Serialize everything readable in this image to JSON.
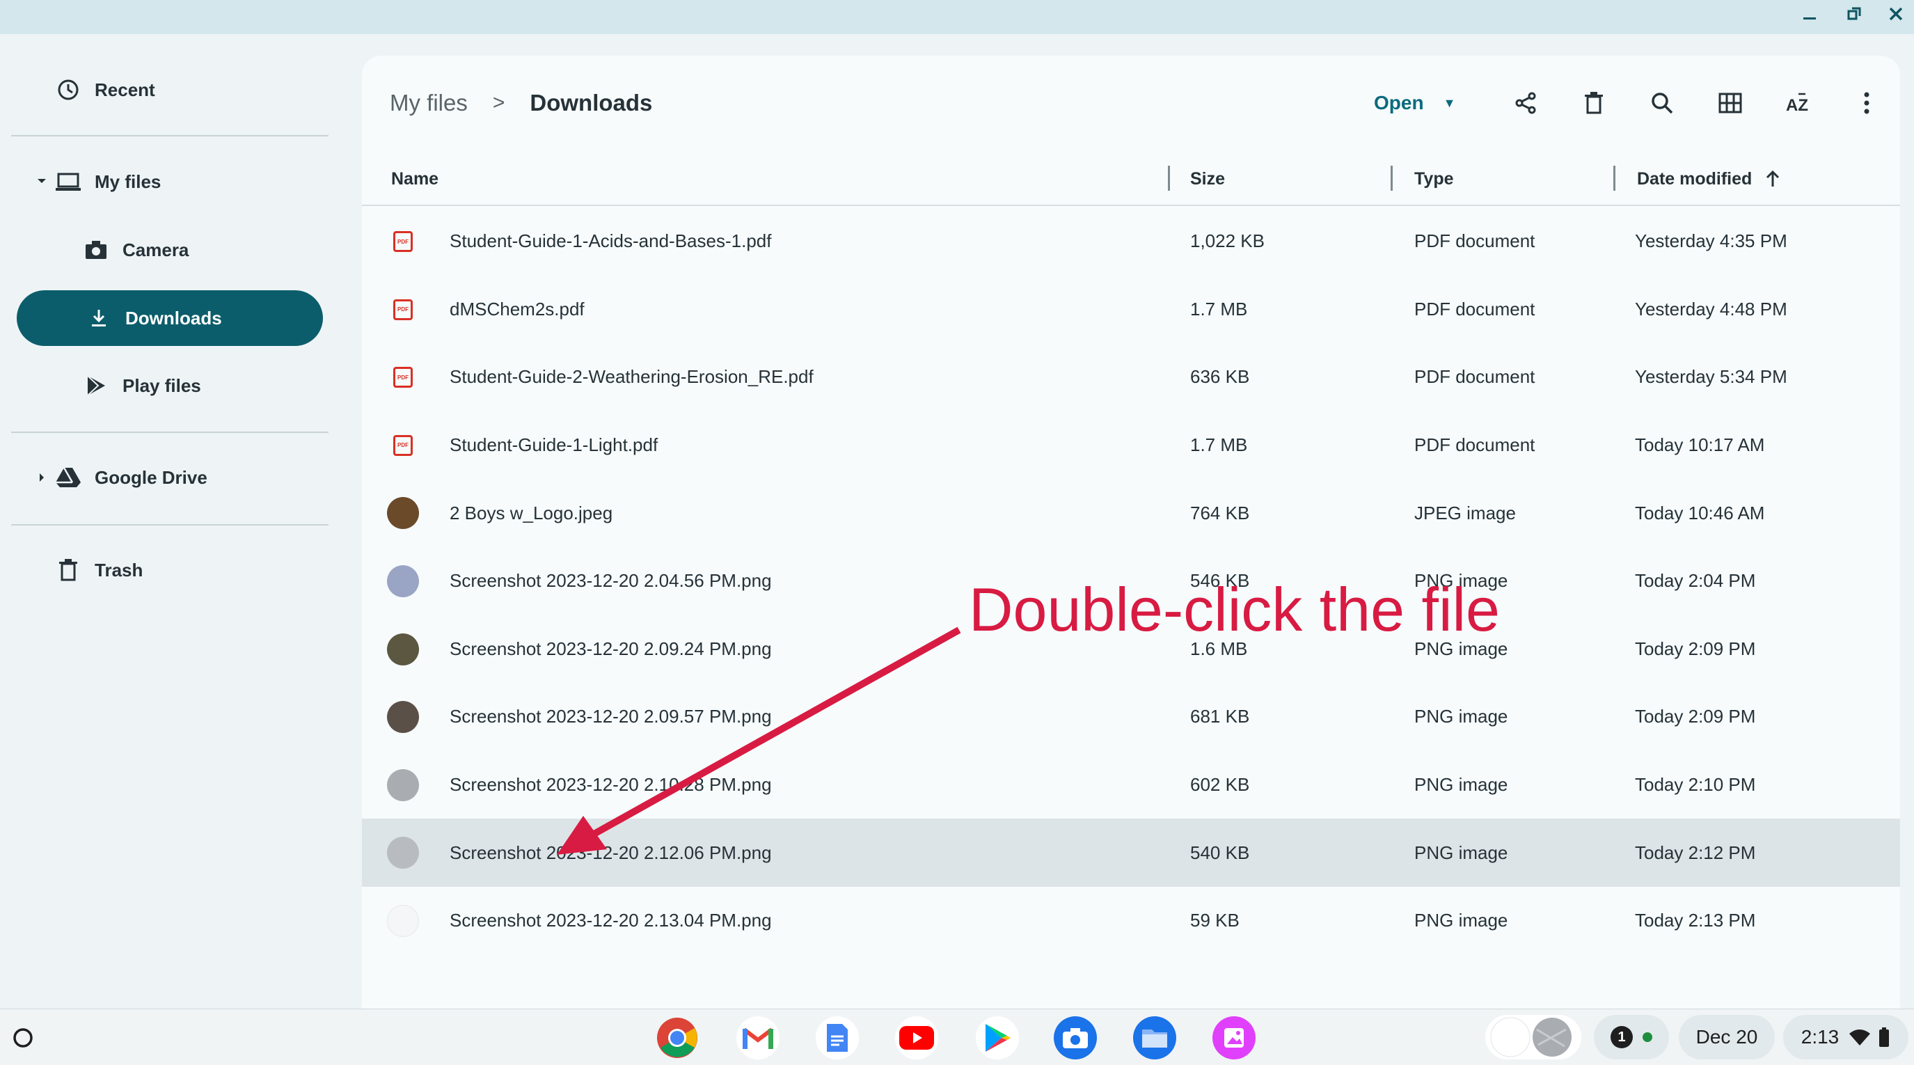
{
  "sidebar": {
    "recent": "Recent",
    "my_files": "My files",
    "camera": "Camera",
    "downloads": "Downloads",
    "play_files": "Play files",
    "google_drive": "Google Drive",
    "trash": "Trash"
  },
  "header": {
    "breadcrumb_root": "My files",
    "breadcrumb_sep": ">",
    "breadcrumb_current": "Downloads",
    "open_label": "Open"
  },
  "columns": {
    "name": "Name",
    "size": "Size",
    "type": "Type",
    "date": "Date modified"
  },
  "files": [
    {
      "name": "Student-Guide-1-Acids-and-Bases-1.pdf",
      "size": "1,022 KB",
      "type": "PDF document",
      "date": "Yesterday 4:35 PM",
      "kind": "pdf"
    },
    {
      "name": "dMSChem2s.pdf",
      "size": "1.7 MB",
      "type": "PDF document",
      "date": "Yesterday 4:48 PM",
      "kind": "pdf"
    },
    {
      "name": "Student-Guide-2-Weathering-Erosion_RE.pdf",
      "size": "636 KB",
      "type": "PDF document",
      "date": "Yesterday 5:34 PM",
      "kind": "pdf"
    },
    {
      "name": "Student-Guide-1-Light.pdf",
      "size": "1.7 MB",
      "type": "PDF document",
      "date": "Today 10:17 AM",
      "kind": "pdf"
    },
    {
      "name": "2 Boys w_Logo.jpeg",
      "size": "764 KB",
      "type": "JPEG image",
      "date": "Today 10:46 AM",
      "kind": "img",
      "color": "#6b4a2a"
    },
    {
      "name": "Screenshot 2023-12-20 2.04.56 PM.png",
      "size": "546 KB",
      "type": "PNG image",
      "date": "Today 2:04 PM",
      "kind": "img",
      "color": "#9aa4c4"
    },
    {
      "name": "Screenshot 2023-12-20 2.09.24 PM.png",
      "size": "1.6 MB",
      "type": "PNG image",
      "date": "Today 2:09 PM",
      "kind": "img",
      "color": "#5b5740"
    },
    {
      "name": "Screenshot 2023-12-20 2.09.57 PM.png",
      "size": "681 KB",
      "type": "PNG image",
      "date": "Today 2:09 PM",
      "kind": "img",
      "color": "#5a5048"
    },
    {
      "name": "Screenshot 2023-12-20 2.10.28 PM.png",
      "size": "602 KB",
      "type": "PNG image",
      "date": "Today 2:10 PM",
      "kind": "img",
      "color": "#a9adb2"
    },
    {
      "name": "Screenshot 2023-12-20 2.12.06 PM.png",
      "size": "540 KB",
      "type": "PNG image",
      "date": "Today 2:12 PM",
      "kind": "img",
      "color": "#b8bcc0",
      "selected": true
    },
    {
      "name": "Screenshot 2023-12-20 2.13.04 PM.png",
      "size": "59 KB",
      "type": "PNG image",
      "date": "Today 2:13 PM",
      "kind": "img",
      "color": "#f4f6f7"
    }
  ],
  "annotation": {
    "text": "Double-click the file",
    "color": "#d81b42"
  },
  "shelf": {
    "notification_count": "1",
    "date": "Dec 20",
    "time": "2:13"
  }
}
